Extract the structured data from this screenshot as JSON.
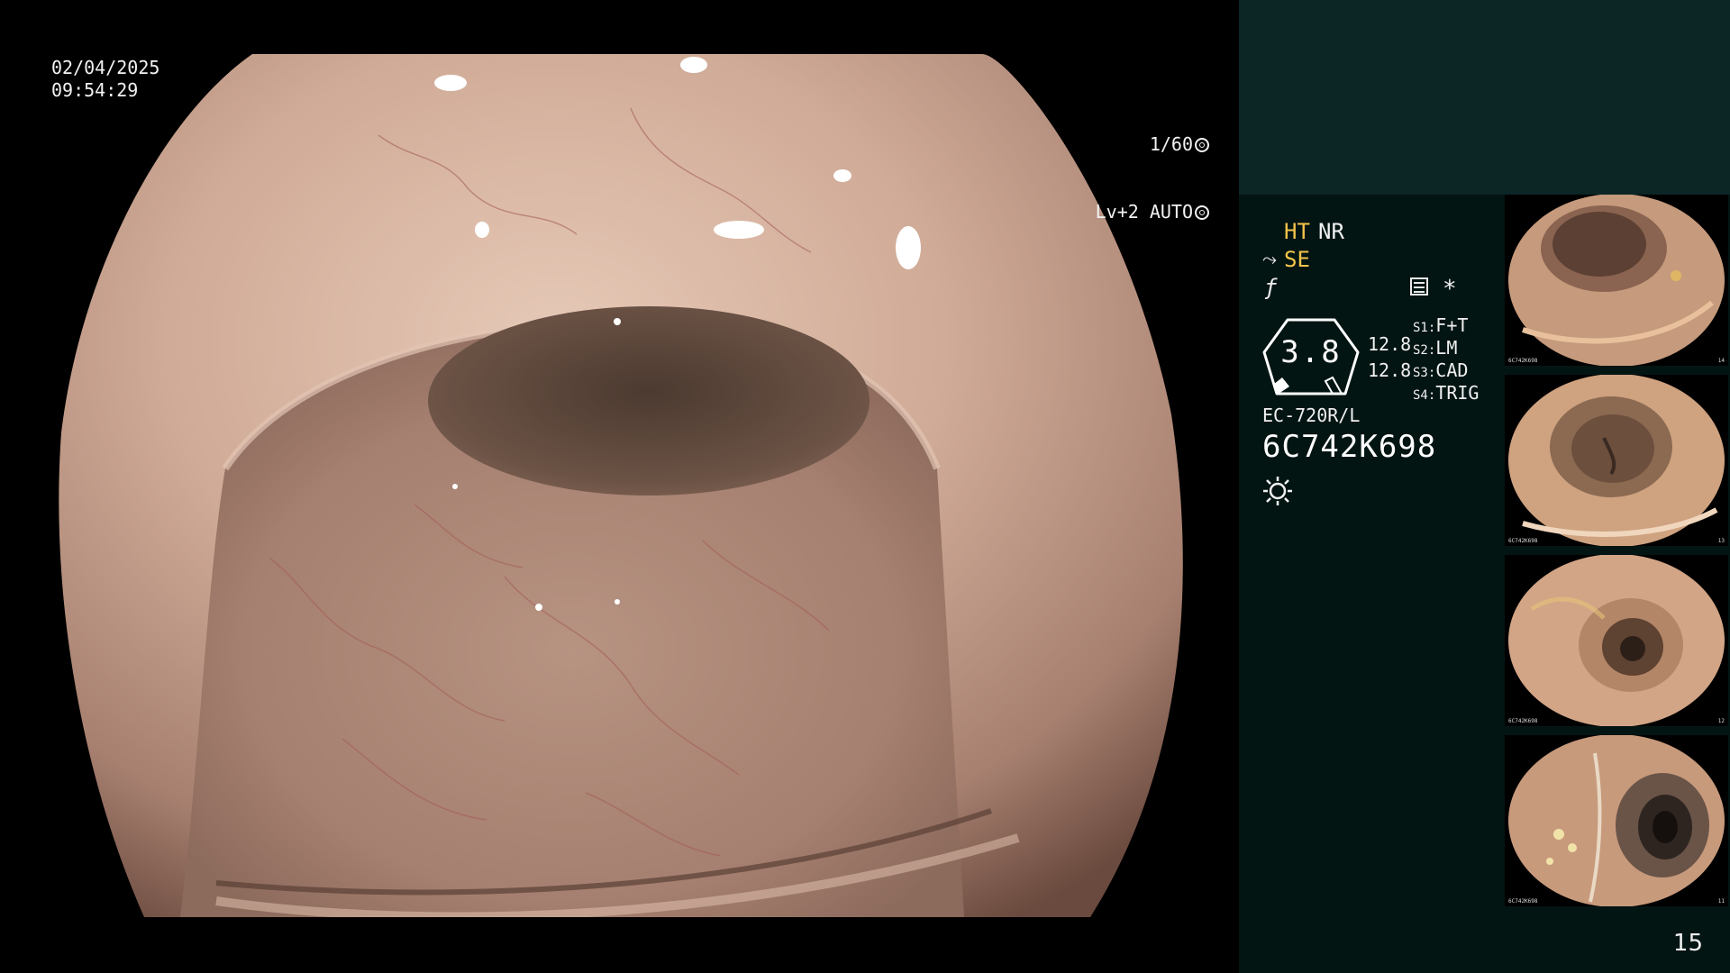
{
  "main": {
    "date": "02/04/2025",
    "time": "09:54:29",
    "shutter_speed": "1/60",
    "level_mode": "Lv+2 AUTO"
  },
  "panel": {
    "mode_ht": "HT",
    "mode_nr": "NR",
    "mode_se": "SE",
    "gauge_value": "3.8",
    "value_1": "12.8",
    "value_2": "12.8",
    "switches": [
      {
        "key": "S1",
        "label": "F+T"
      },
      {
        "key": "S2",
        "label": "LM"
      },
      {
        "key": "S3",
        "label": "CAD"
      },
      {
        "key": "S4",
        "label": "TRIG"
      }
    ],
    "scope_model": "EC-720R/L",
    "scope_serial": "6C742K698",
    "icons": [
      "se-curve-icon",
      "f-strike-icon",
      "book-icon",
      "asterisk-icon",
      "light-sun-icon",
      "shutter-icon",
      "iris-icon"
    ]
  },
  "thumbnails": [
    {
      "caption": "6C742K698",
      "index": "14"
    },
    {
      "caption": "6C742K698",
      "index": "13"
    },
    {
      "caption": "6C742K698",
      "index": "12"
    },
    {
      "caption": "6C742K698",
      "index": "11"
    }
  ],
  "page_number": "15"
}
